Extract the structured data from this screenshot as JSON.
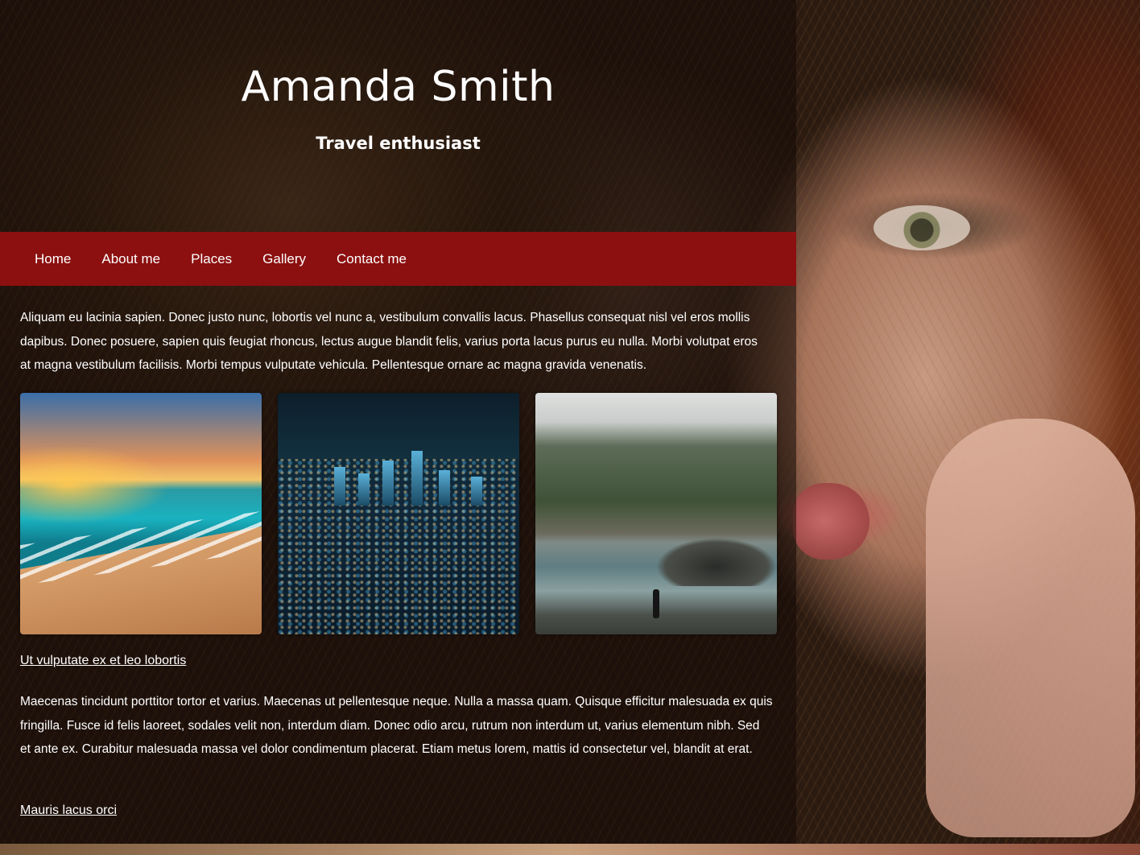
{
  "header": {
    "title": "Amanda Smith",
    "subtitle": "Travel enthusiast"
  },
  "nav": {
    "items": [
      "Home",
      "About me",
      "Places",
      "Gallery",
      "Contact me"
    ]
  },
  "main": {
    "intro_paragraph": "Aliquam eu lacinia sapien. Donec justo nunc, lobortis vel nunc a, vestibulum convallis lacus. Phasellus consequat nisl vel eros mollis dapibus. Donec posuere, sapien quis feugiat rhoncus, lectus augue blandit felis, varius porta lacus purus eu nulla. Morbi volutpat eros at magna vestibulum facilisis. Morbi tempus vulputate vehicula. Pellentesque ornare ac magna gravida venenatis.",
    "gallery": [
      {
        "name": "beach-photo",
        "depicts": "sunset beach with waves"
      },
      {
        "name": "city-photo",
        "depicts": "city skyline at night"
      },
      {
        "name": "river-photo",
        "depicts": "person standing by a river in a misty forest valley"
      }
    ],
    "link_1": "Ut vulputate ex et leo lobortis",
    "second_paragraph": "Maecenas tincidunt porttitor tortor et varius. Maecenas ut pellentesque neque. Nulla a massa quam. Quisque efficitur malesuada ex quis fringilla. Fusce id felis laoreet, sodales velit non, interdum diam. Donec odio arcu, rutrum non interdum ut, varius elementum nibh. Sed et ante ex. Curabitur malesuada massa vel dolor condimentum placerat. Etiam metus lorem, mattis id consectetur vel, blandit at erat.",
    "link_2": "Mauris lacus orci"
  },
  "colors": {
    "nav_background": "#8c1010",
    "text": "#ffffff",
    "panel_overlay": "rgba(18,10,6,0.55)"
  }
}
